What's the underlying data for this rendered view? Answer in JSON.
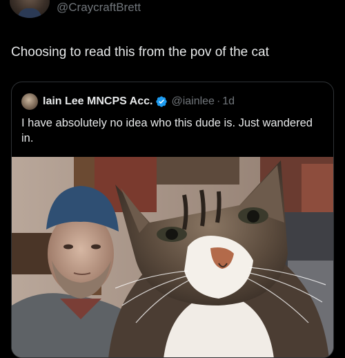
{
  "top": {
    "handle": "@CraycraftBrett"
  },
  "tweet": {
    "text": "Choosing to read this from the pov of the cat"
  },
  "quote": {
    "author_name": "Iain Lee MNCPS Acc.",
    "author_handle": "@iainlee",
    "separator": "·",
    "time": "1d",
    "text": "I have absolutely no idea who this dude is. Just wandered in."
  },
  "icons": {
    "verified": "verified-badge-icon",
    "avatar": "avatar"
  },
  "colors": {
    "background": "#000000",
    "text_primary": "#e7e9ea",
    "text_secondary": "#71767b",
    "border": "#2f3336",
    "verified_blue": "#1d9bf0"
  }
}
